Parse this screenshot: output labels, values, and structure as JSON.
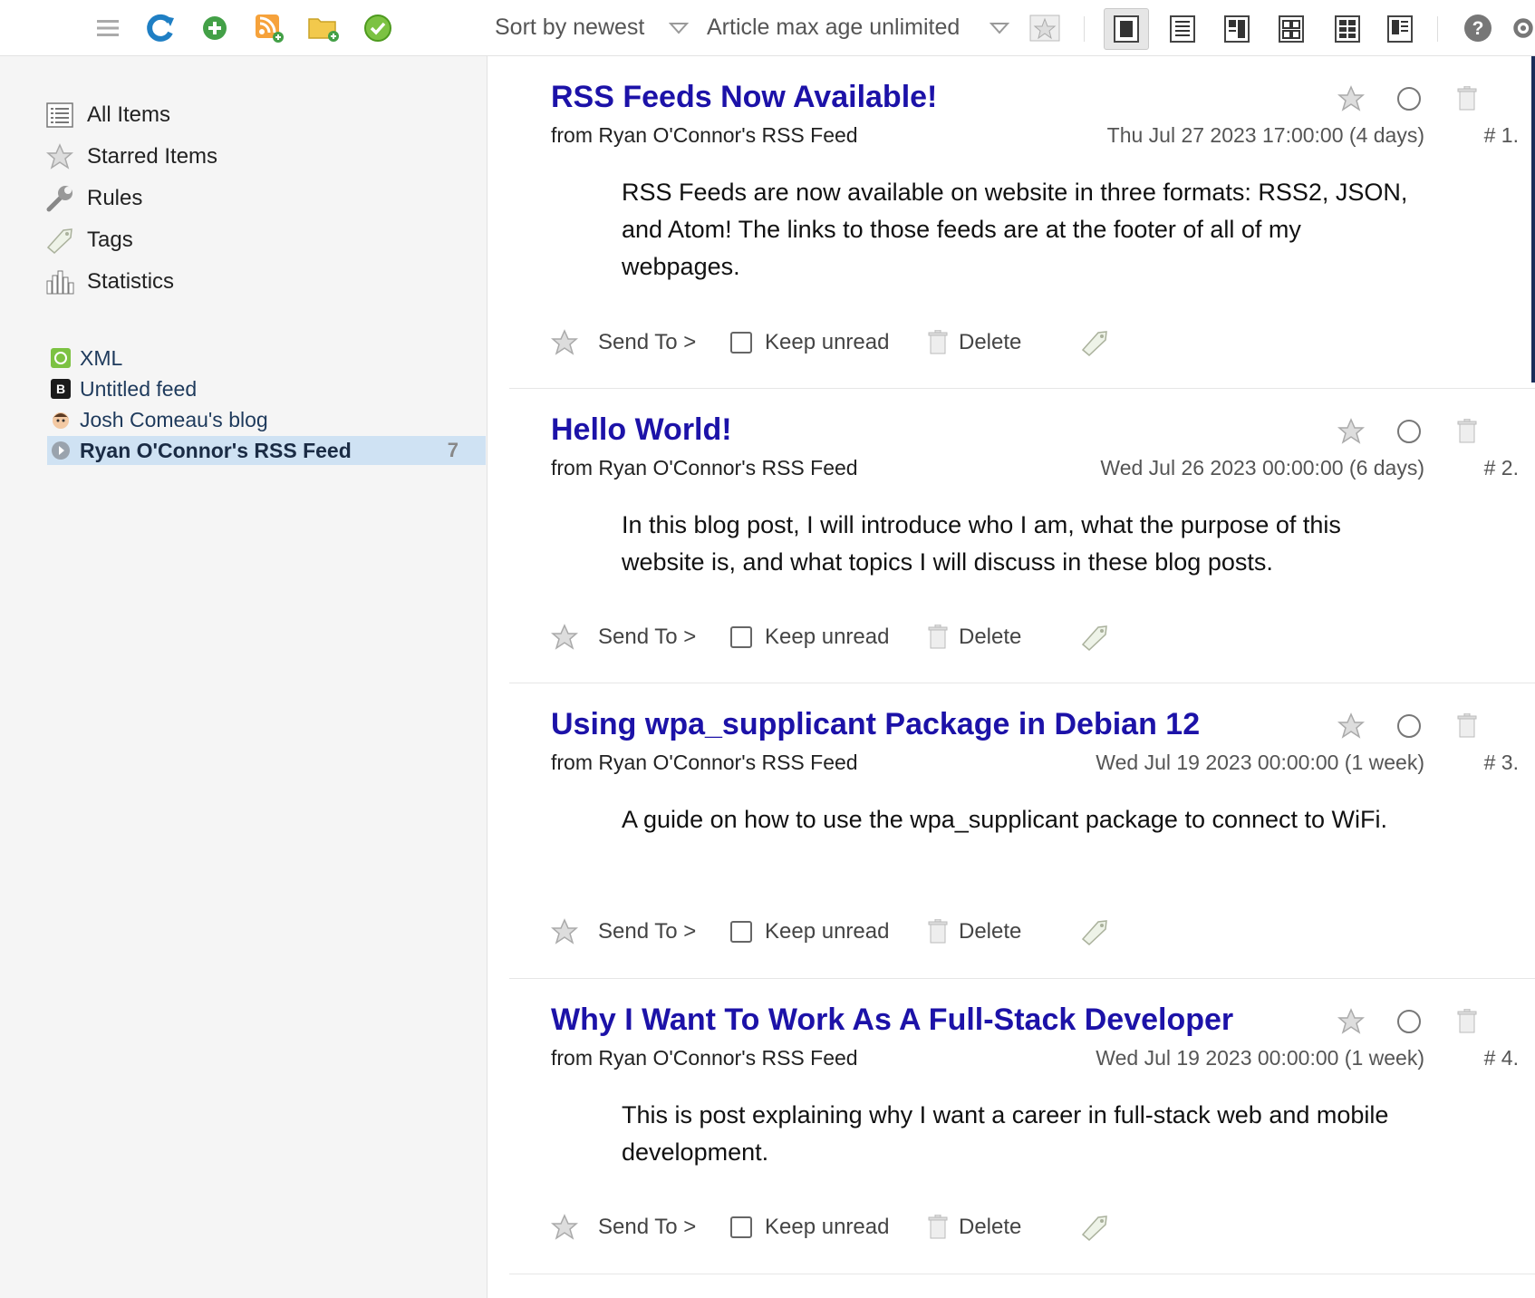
{
  "toolbar": {
    "icons": [
      "menu-icon",
      "refresh-icon",
      "add-icon",
      "add-feed-icon",
      "add-folder-icon",
      "mark-read-icon"
    ],
    "sort_label": "Sort by newest",
    "age_label": "Article max age unlimited",
    "view_modes": [
      "view-full-icon",
      "view-list-icon",
      "view-split-icon",
      "view-grid-icon",
      "view-compact-icon",
      "view-detail-icon"
    ],
    "active_view_index": 0,
    "help_icon": "help-icon",
    "settings_icon": "gear-icon"
  },
  "sidebar": {
    "nav": [
      {
        "label": "All Items",
        "icon": "list-icon"
      },
      {
        "label": "Starred Items",
        "icon": "star-icon"
      },
      {
        "label": "Rules",
        "icon": "wrench-icon"
      },
      {
        "label": "Tags",
        "icon": "tag-icon"
      },
      {
        "label": "Statistics",
        "icon": "chart-icon"
      }
    ],
    "feeds": [
      {
        "label": "XML",
        "icon": "xml-feed-icon",
        "count": ""
      },
      {
        "label": "Untitled feed",
        "icon": "b-feed-icon",
        "count": ""
      },
      {
        "label": "Josh Comeau's blog",
        "icon": "avatar-feed-icon",
        "count": ""
      },
      {
        "label": "Ryan O'Connor's RSS Feed",
        "icon": "play-feed-icon",
        "count": "7",
        "selected": true
      }
    ]
  },
  "articles": [
    {
      "title": "RSS Feeds Now Available!",
      "from": "from Ryan O'Connor's RSS Feed",
      "date": "Thu Jul 27 2023 17:00:00 (4 days)",
      "num": "# 1.",
      "body": "RSS Feeds are now available on website in three formats: RSS2, JSON, and Atom! The links to those feeds are at the footer of all of my webpages."
    },
    {
      "title": "Hello World!",
      "from": "from Ryan O'Connor's RSS Feed",
      "date": "Wed Jul 26 2023 00:00:00 (6 days)",
      "num": "# 2.",
      "body": "In this blog post, I will introduce who I am, what the purpose of this website is, and what topics I will discuss in these blog posts."
    },
    {
      "title": "Using wpa_supplicant Package in Debian 12",
      "from": "from Ryan O'Connor's RSS Feed",
      "date": "Wed Jul 19 2023 00:00:00 (1 week)",
      "num": "# 3.",
      "body": "A guide on how to use the wpa_supplicant package to connect to WiFi."
    },
    {
      "title": "Why I Want To Work As A Full-Stack Developer",
      "from": "from Ryan O'Connor's RSS Feed",
      "date": "Wed Jul 19 2023 00:00:00 (1 week)",
      "num": "# 4.",
      "body": "This is post explaining why I want a career in full-stack web and mobile development."
    }
  ],
  "actions": {
    "send_to": "Send To >",
    "keep_unread": "Keep unread",
    "delete": "Delete"
  },
  "colors": {
    "title": "#1c12a8",
    "selected_feed_bg": "#cfe2f3",
    "sidebar_bg": "#f5f5f5"
  }
}
